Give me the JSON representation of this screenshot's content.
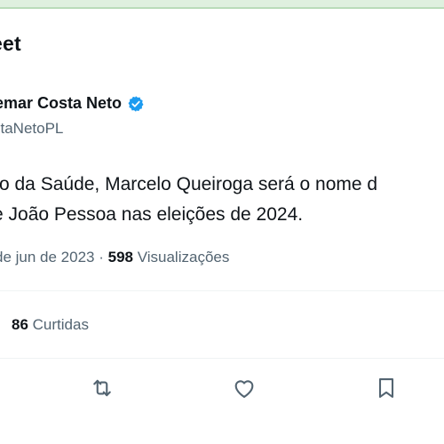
{
  "header": {
    "title": "eet"
  },
  "author": {
    "name": "emar Costa Neto",
    "handle": "staNetoPL"
  },
  "tweet": {
    "line1": "ro da Saúde, Marcelo Queiroga será o nome d",
    "line2": "e João Pessoa nas eleições de 2024."
  },
  "meta": {
    "date": "de jun de 2023",
    "separator": " · ",
    "views_count": "598",
    "views_label": "Visualizações"
  },
  "stats": {
    "likes_count": "86",
    "likes_label": "Curtidas"
  },
  "colors": {
    "text": "#0f1419",
    "muted": "#536471",
    "verified": "#1d9bf0",
    "divider": "#eff3f4"
  },
  "icons": {
    "verified": "verified-badge-icon",
    "retweet": "retweet-icon",
    "like": "heart-icon",
    "bookmark": "bookmark-icon"
  }
}
